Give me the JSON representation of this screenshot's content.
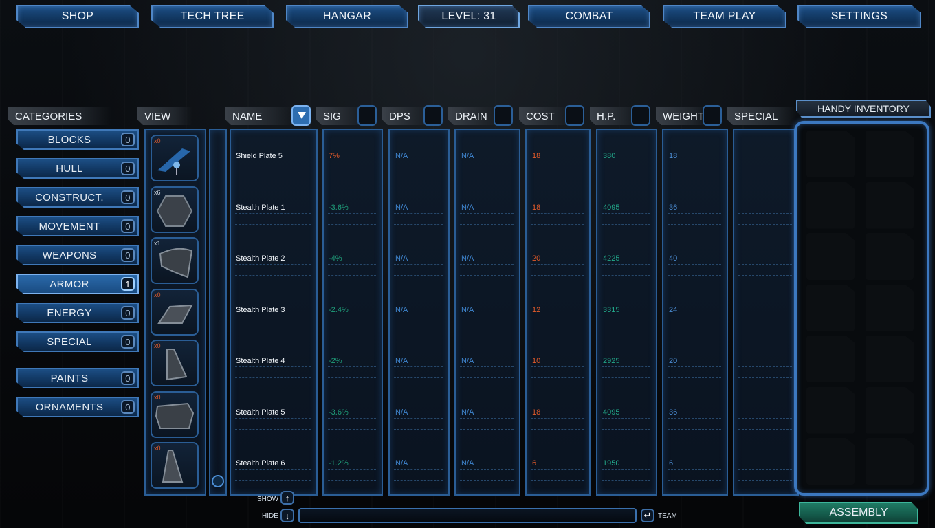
{
  "top_nav": {
    "shop": "SHOP",
    "tech_tree": "TECH TREE",
    "hangar": "HANGAR",
    "level": "LEVEL: 31",
    "combat": "COMBAT",
    "team_play": "TEAM PLAY",
    "settings": "SETTINGS"
  },
  "headers": {
    "categories": "CATEGORIES",
    "view": "VIEW",
    "name": "NAME",
    "sig": "SIG",
    "dps": "DPS",
    "drain": "DRAIN",
    "cost": "COST",
    "hp": "H.P.",
    "weight": "WEIGHT",
    "special": "SPECIAL",
    "handy_inventory": "HANDY INVENTORY"
  },
  "categories": [
    {
      "label": "BLOCKS",
      "count": "0",
      "selected": false
    },
    {
      "label": "HULL",
      "count": "0",
      "selected": false
    },
    {
      "label": "CONSTRUCT.",
      "count": "0",
      "selected": false
    },
    {
      "label": "MOVEMENT",
      "count": "0",
      "selected": false
    },
    {
      "label": "WEAPONS",
      "count": "0",
      "selected": false
    },
    {
      "label": "ARMOR",
      "count": "1",
      "selected": true
    },
    {
      "label": "ENERGY",
      "count": "0",
      "selected": false
    },
    {
      "label": "SPECIAL",
      "count": "0",
      "selected": false
    },
    {
      "label": "PAINTS",
      "count": "0",
      "selected": false
    },
    {
      "label": "ORNAMENTS",
      "count": "0",
      "selected": false
    }
  ],
  "items": [
    {
      "qty": "x0",
      "name": "Shield Plate 5",
      "sig": "7%",
      "dps": "N/A",
      "drain": "N/A",
      "cost": "18",
      "hp": "380",
      "weight": "18",
      "icon": "shield-plate-icon"
    },
    {
      "qty": "x6",
      "name": "Stealth Plate 1",
      "sig": "-3.6%",
      "dps": "N/A",
      "drain": "N/A",
      "cost": "18",
      "hp": "4095",
      "weight": "36",
      "icon": "hexagon-plate-icon"
    },
    {
      "qty": "x1",
      "name": "Stealth Plate 2",
      "sig": "-4%",
      "dps": "N/A",
      "drain": "N/A",
      "cost": "20",
      "hp": "4225",
      "weight": "40",
      "icon": "curved-plate-icon"
    },
    {
      "qty": "x0",
      "name": "Stealth Plate 3",
      "sig": "-2.4%",
      "dps": "N/A",
      "drain": "N/A",
      "cost": "12",
      "hp": "3315",
      "weight": "24",
      "icon": "flat-plate-icon"
    },
    {
      "qty": "x0",
      "name": "Stealth Plate 4",
      "sig": "-2%",
      "dps": "N/A",
      "drain": "N/A",
      "cost": "10",
      "hp": "2925",
      "weight": "20",
      "icon": "wedge-plate-icon"
    },
    {
      "qty": "x0",
      "name": "Stealth Plate 5",
      "sig": "-3.6%",
      "dps": "N/A",
      "drain": "N/A",
      "cost": "18",
      "hp": "4095",
      "weight": "36",
      "icon": "slab-plate-icon"
    },
    {
      "qty": "x0",
      "name": "Stealth Plate 6",
      "sig": "-1.2%",
      "dps": "N/A",
      "drain": "N/A",
      "cost": "6",
      "hp": "1950",
      "weight": "6",
      "icon": "fin-plate-icon"
    }
  ],
  "bottom": {
    "show": "SHOW",
    "hide": "HIDE",
    "team": "TEAM",
    "assembly": "ASSEMBLY"
  },
  "colors": {
    "accent": "#4f86c6",
    "positive": "#1f9e7a",
    "negative": "#e05a2a",
    "na": "#3f86d0",
    "hp": "#22a88a",
    "weight": "#4d8fd6"
  }
}
